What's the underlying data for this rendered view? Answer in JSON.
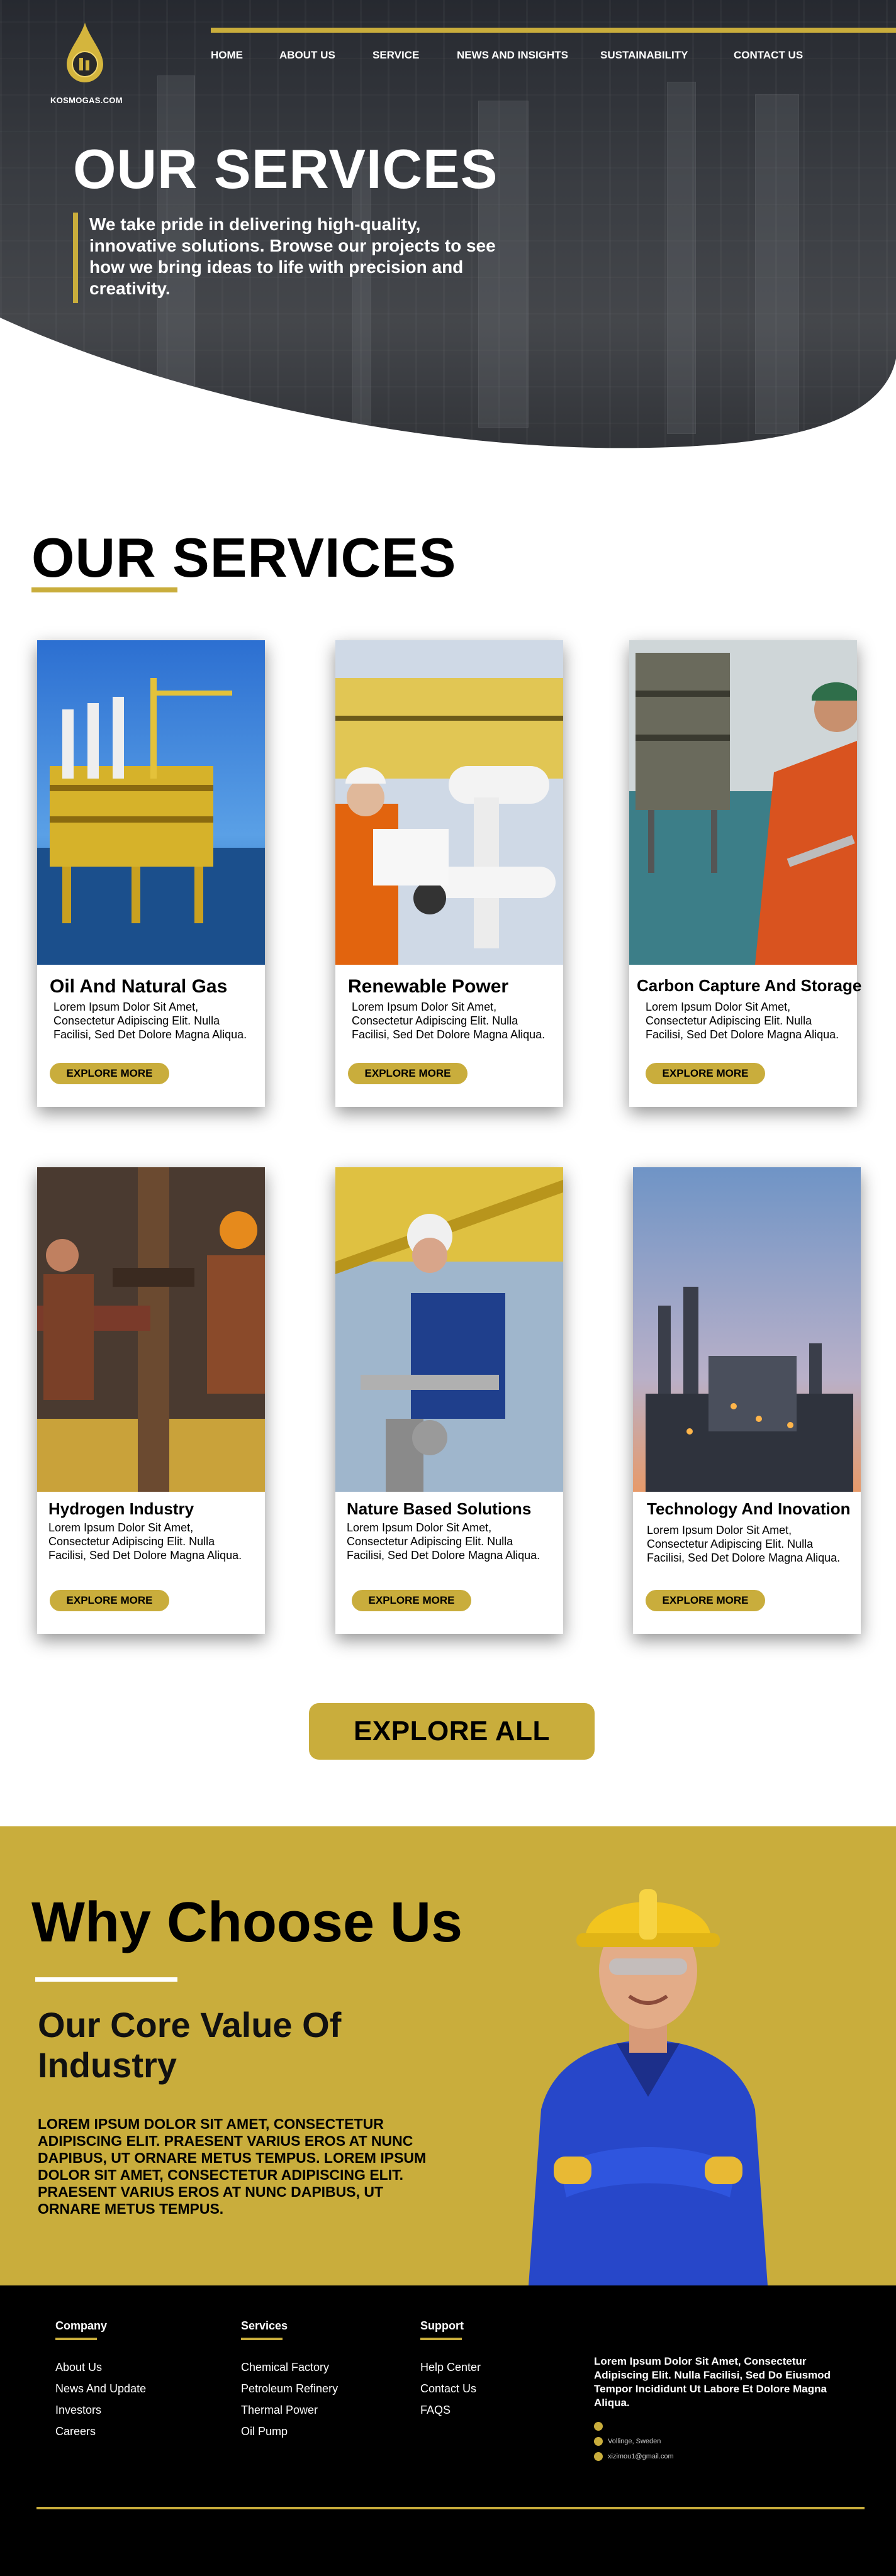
{
  "brand": {
    "name": "KOSMOGAS.COM"
  },
  "nav": {
    "items": [
      "HOME",
      "ABOUT US",
      "SERVICE",
      "NEWS AND INSIGHTS",
      "SUSTAINABILITY",
      "CONTACT US"
    ]
  },
  "hero": {
    "title": "OUR SERVICES",
    "subtitle": "We take pride in delivering high-quality, innovative solutions. Browse our projects to see how we bring ideas to life with precision and creativity."
  },
  "services": {
    "title": "OUR SERVICES",
    "cards": [
      {
        "title": "Oil And Natural Gas",
        "desc": "Lorem Ipsum Dolor Sit Amet, Consectetur Adipiscing Elit. Nulla Facilisi, Sed Det Dolore Magna Aliqua.",
        "button": "EXPLORE MORE"
      },
      {
        "title": "Renewable Power",
        "desc": "Lorem Ipsum Dolor Sit Amet, Consectetur Adipiscing Elit. Nulla Facilisi, Sed Det Dolore Magna Aliqua.",
        "button": "EXPLORE MORE"
      },
      {
        "title": "Carbon Capture And Storage",
        "desc": "Lorem Ipsum Dolor Sit Amet, Consectetur Adipiscing Elit. Nulla Facilisi, Sed Det Dolore Magna Aliqua.",
        "button": "EXPLORE MORE"
      },
      {
        "title": "Hydrogen Industry",
        "desc": "Lorem Ipsum Dolor Sit Amet, Consectetur Adipiscing Elit. Nulla Facilisi, Sed Det Dolore Magna Aliqua.",
        "button": "EXPLORE MORE"
      },
      {
        "title": "Nature Based Solutions",
        "desc": "Lorem Ipsum Dolor Sit Amet, Consectetur Adipiscing Elit. Nulla Facilisi, Sed Det Dolore Magna Aliqua.",
        "button": "EXPLORE MORE"
      },
      {
        "title": "Technology And Inovation",
        "desc": "Lorem Ipsum Dolor Sit Amet, Consectetur Adipiscing Elit. Nulla Facilisi, Sed Det Dolore Magna Aliqua.",
        "button": "EXPLORE MORE"
      }
    ],
    "explore_all": "EXPLORE ALL"
  },
  "why": {
    "title": "Why Choose Us",
    "subtitle": "Our Core Value Of Industry",
    "text": "LOREM IPSUM DOLOR SIT AMET, CONSECTETUR ADIPISCING ELIT. PRAESENT VARIUS EROS AT NUNC DAPIBUS, UT ORNARE METUS TEMPUS. LOREM IPSUM DOLOR SIT AMET, CONSECTETUR ADIPISCING ELIT. PRAESENT VARIUS EROS AT NUNC DAPIBUS, UT ORNARE METUS TEMPUS."
  },
  "footer": {
    "company": {
      "heading": "Company",
      "links": [
        "About Us",
        "News And Update",
        "Investors",
        "Careers"
      ]
    },
    "services": {
      "heading": "Services",
      "links": [
        "Chemical Factory",
        "Petroleum Refinery",
        "Thermal Power",
        "Oil Pump"
      ]
    },
    "support": {
      "heading": "Support",
      "links": [
        "Help Center",
        "Contact Us",
        "FAQS"
      ]
    },
    "about": "Lorem Ipsum Dolor Sit Amet, Consectetur Adipiscing Elit. Nulla Facilisi, Sed Do Eiusmod Tempor Incididunt Ut Labore Et Dolore Magna Aliqua.",
    "contact": {
      "phone": "",
      "address": "Vollinge, Sweden",
      "email": "xizimou1@gmail.com"
    }
  },
  "colors": {
    "accent": "#c9ad3c",
    "dark": "#000000",
    "hero_overlay": "#3c3f45"
  },
  "icons": [
    "water-drop-logo-icon",
    "phone-icon",
    "location-pin-icon",
    "mail-icon"
  ]
}
